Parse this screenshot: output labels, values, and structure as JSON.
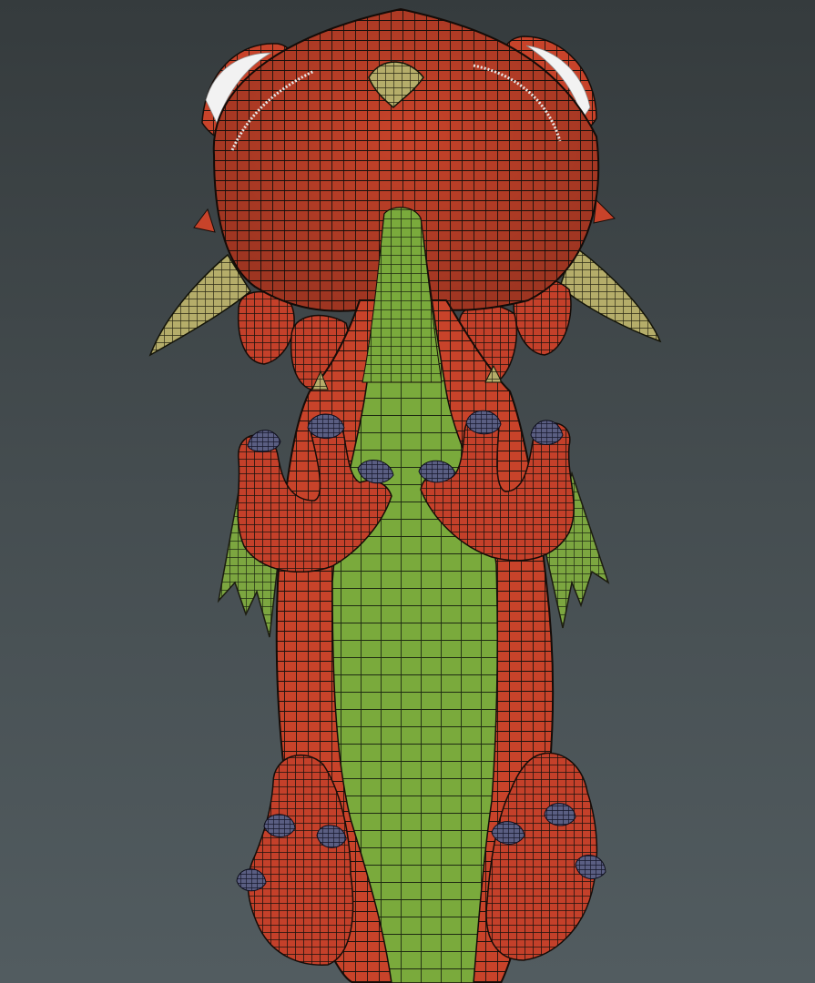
{
  "viewport": {
    "background_top": "#353b3d",
    "background_bottom": "#525c60"
  },
  "model": {
    "subject": "dragon",
    "view": "underside",
    "display": "wireframe-on-shaded",
    "colors": {
      "body_red": "#c8432a",
      "belly_green": "#7aaa3c",
      "claw_blue": "#5a5e82",
      "horn_tan": "#b5ad6a",
      "eye_white": "#f2f2f2",
      "wire": "#1c120e"
    }
  }
}
